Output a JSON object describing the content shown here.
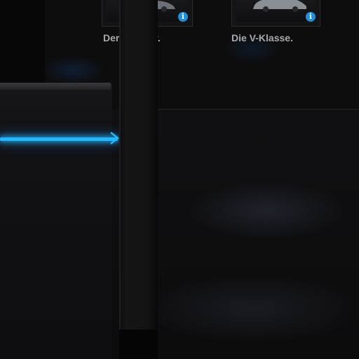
{
  "vehicle_cards": [
    {
      "caption": "Der",
      "caption_tail": "er.",
      "info_icon": "info-icon"
    },
    {
      "caption": "Die V-Klasse.",
      "info_icon": "info-icon"
    }
  ],
  "info_glyph": "i",
  "colors": {
    "accent_light": "#22b8ff",
    "info_badge": "#1e90e0",
    "caption_text": "#a9a9ad",
    "background": "#0a0a0b"
  },
  "icons": {
    "navigation_arrow": "chevron-right-icon",
    "info": "info-icon"
  }
}
